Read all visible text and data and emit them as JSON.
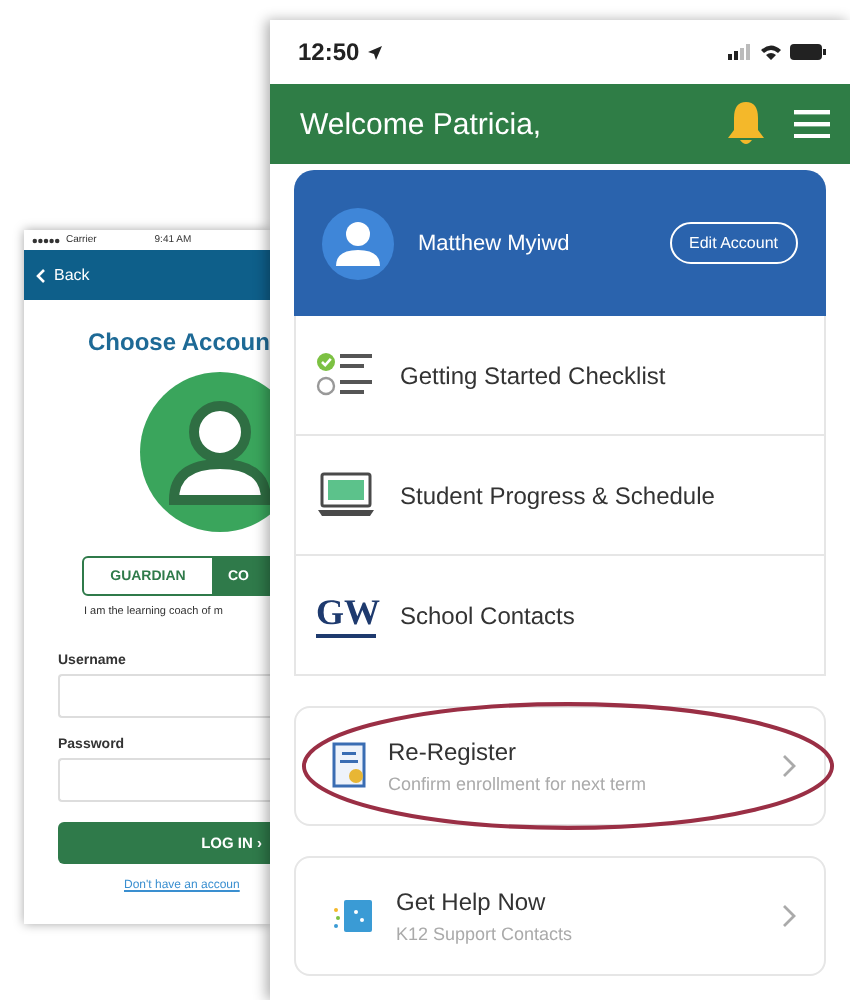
{
  "back_screen": {
    "status_bar": {
      "carrier": "Carrier",
      "time": "9:41 AM"
    },
    "back_button": "Back",
    "title": "Choose Accoun",
    "account_tabs": [
      {
        "label": "GUARDIAN",
        "selected": false
      },
      {
        "label": "CO",
        "selected": true
      }
    ],
    "description": "I am the learning coach of m",
    "username": {
      "label": "Username"
    },
    "password": {
      "label": "Password"
    },
    "login_button": "LOG IN ›",
    "signup_link": "Don't have an accoun"
  },
  "front_screen": {
    "status_bar": {
      "time": "12:50"
    },
    "header": {
      "title": "Welcome Patricia,"
    },
    "account": {
      "name": "Matthew Myiwd",
      "edit_button": "Edit Account"
    },
    "menu_items": [
      {
        "kind": "checklist",
        "label": "Getting Started Checklist"
      },
      {
        "kind": "progress",
        "label": "Student Progress & Schedule"
      },
      {
        "kind": "contacts",
        "logo": "GW",
        "label": "School Contacts"
      }
    ],
    "cards": [
      {
        "kind": "register",
        "title": "Re-Register",
        "subtitle": "Confirm enrollment for next term",
        "highlighted": true
      },
      {
        "kind": "help",
        "title": "Get Help Now",
        "subtitle": "K12 Support Contacts",
        "highlighted": false
      }
    ]
  }
}
